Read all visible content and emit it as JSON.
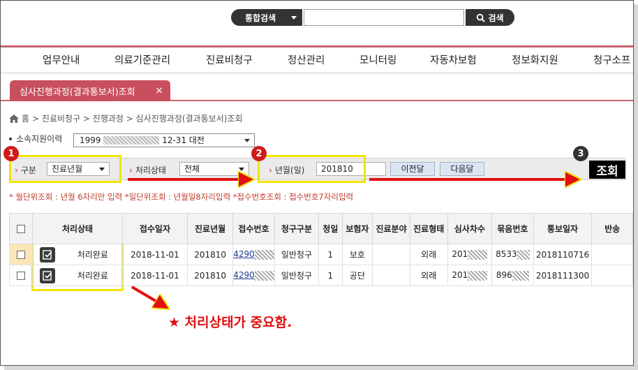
{
  "search": {
    "scope_label": "통합검색",
    "input_value": "",
    "button_label": "검색"
  },
  "gnb": {
    "items": [
      "업무안내",
      "의료기준관리",
      "진료비청구",
      "정산관리",
      "모니터링",
      "자동차보험",
      "정보화지원",
      "청구소프"
    ]
  },
  "tab": {
    "label": "심사진행과정(결과통보서)조회",
    "close": "×"
  },
  "breadcrumb": {
    "home": "홈",
    "path": "> 진료비청구 > 진행과정 > 심사진행과정(결과통보서)조회"
  },
  "branch": {
    "label": "소속지원이력",
    "value_prefix": "1999",
    "value_suffix": "12-31 대전"
  },
  "filters": {
    "category_label": "구분",
    "category_value": "진료년월",
    "status_label": "처리상태",
    "status_value": "전체",
    "month_label": "년월(일)",
    "month_value": "201810",
    "prev_button": "이전달",
    "next_button": "다음달",
    "query_button": "조회"
  },
  "badges": {
    "one": "1",
    "two": "2",
    "three": "3"
  },
  "hint": "* 월단위조회 : 년월 6자리만 입력    *일단위조회 : 년월일8자리입력    *접수번호조회 : 접수번호7자리입력",
  "table": {
    "headers": [
      "",
      "처리상태",
      "접수일자",
      "진료년월",
      "접수번호",
      "청구구분",
      "청일",
      "보험자",
      "진료분야",
      "진료형태",
      "심사차수",
      "묶음번호",
      "통보일자",
      "반송"
    ],
    "rows": [
      {
        "status": "처리완료",
        "recv_date": "2018-11-01",
        "month": "201810",
        "recv_no": "4290",
        "claim_type": "일반청구",
        "cheong": "1",
        "insurer": "보호",
        "field": "",
        "form": "외래",
        "round": "201",
        "bundle": "8533",
        "notice": "2018110716",
        "return": ""
      },
      {
        "status": "처리완료",
        "recv_date": "2018-11-01",
        "month": "201810",
        "recv_no": "4290",
        "claim_type": "일반청구",
        "cheong": "1",
        "insurer": "공단",
        "field": "",
        "form": "외래",
        "round": "201",
        "bundle": "896",
        "notice": "2018111300",
        "return": ""
      }
    ]
  },
  "annotation": {
    "note": "★ 처리상태가 중요함."
  },
  "colors": {
    "accent": "#c8505e",
    "highlight": "#f2e400",
    "annotation": "#e01010"
  }
}
